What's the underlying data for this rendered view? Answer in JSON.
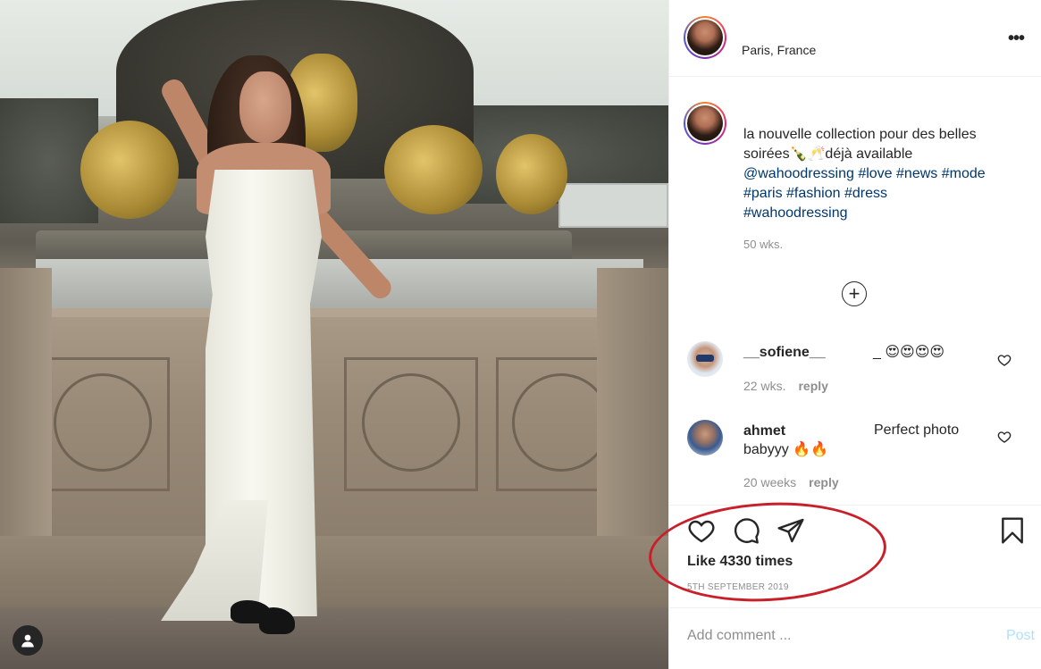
{
  "post": {
    "location": "Paris, France",
    "more_label": "•••",
    "caption": {
      "text_1": "la nouvelle collection pour des belles soirées🍾🥂déjà available ",
      "mention": "@wahoodressing",
      "tags": [
        "#love",
        "#news",
        "#mode",
        "#paris",
        "#fashion",
        "#dress",
        "#wahoodressing"
      ],
      "age": "50 wks."
    },
    "load_more_label": "+",
    "comments": [
      {
        "user": "__sofiene__",
        "text": "_ 😍😍😍😍",
        "age": "22 wks.",
        "reply": "reply"
      },
      {
        "user": "ahmet",
        "text_1": "Perfect photo",
        "text_2": "babyyy 🔥🔥",
        "age": "20 weeks",
        "reply": "reply"
      }
    ],
    "likes": "Like 4330 times",
    "date": "5TH SEPTEMBER 2019"
  },
  "add_comment": {
    "placeholder": "Add comment ...",
    "post_label": "Post"
  },
  "icons": {
    "like": "heart-icon",
    "comment": "comment-icon",
    "share": "paper-plane-icon",
    "save": "bookmark-icon",
    "profile": "user-icon"
  },
  "colors": {
    "highlight": "#c8202a",
    "link": "#00376b",
    "muted": "#8e8e8e",
    "post_button": "#b2dffc"
  }
}
